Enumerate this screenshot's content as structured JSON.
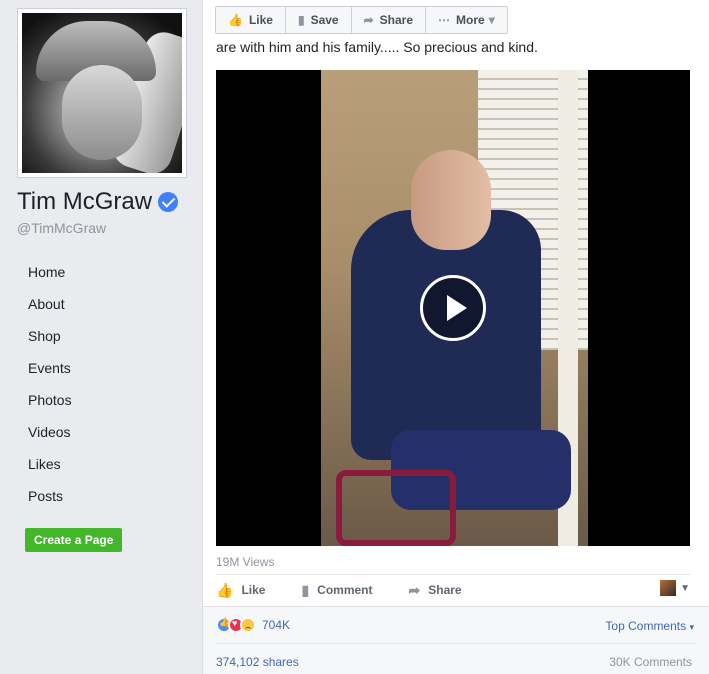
{
  "profile": {
    "name": "Tim McGraw",
    "handle": "@TimMcGraw"
  },
  "nav": {
    "items": [
      "Home",
      "About",
      "Shop",
      "Events",
      "Photos",
      "Videos",
      "Likes",
      "Posts"
    ]
  },
  "create_page_label": "Create a Page",
  "top_actions": {
    "like": "Like",
    "save": "Save",
    "share": "Share",
    "more": "More"
  },
  "post": {
    "text": "are with him and his family..... So precious and kind.",
    "views": "19M Views"
  },
  "ufi": {
    "like": "Like",
    "comment": "Comment",
    "share": "Share"
  },
  "feedback": {
    "reaction_count": "704K",
    "top_comments": "Top Comments",
    "shares": "374,102 shares",
    "comments": "30K Comments"
  },
  "colors": {
    "link_blue": "#4267b2",
    "create_green": "#42b72a",
    "verified_blue": "#4080ff"
  }
}
